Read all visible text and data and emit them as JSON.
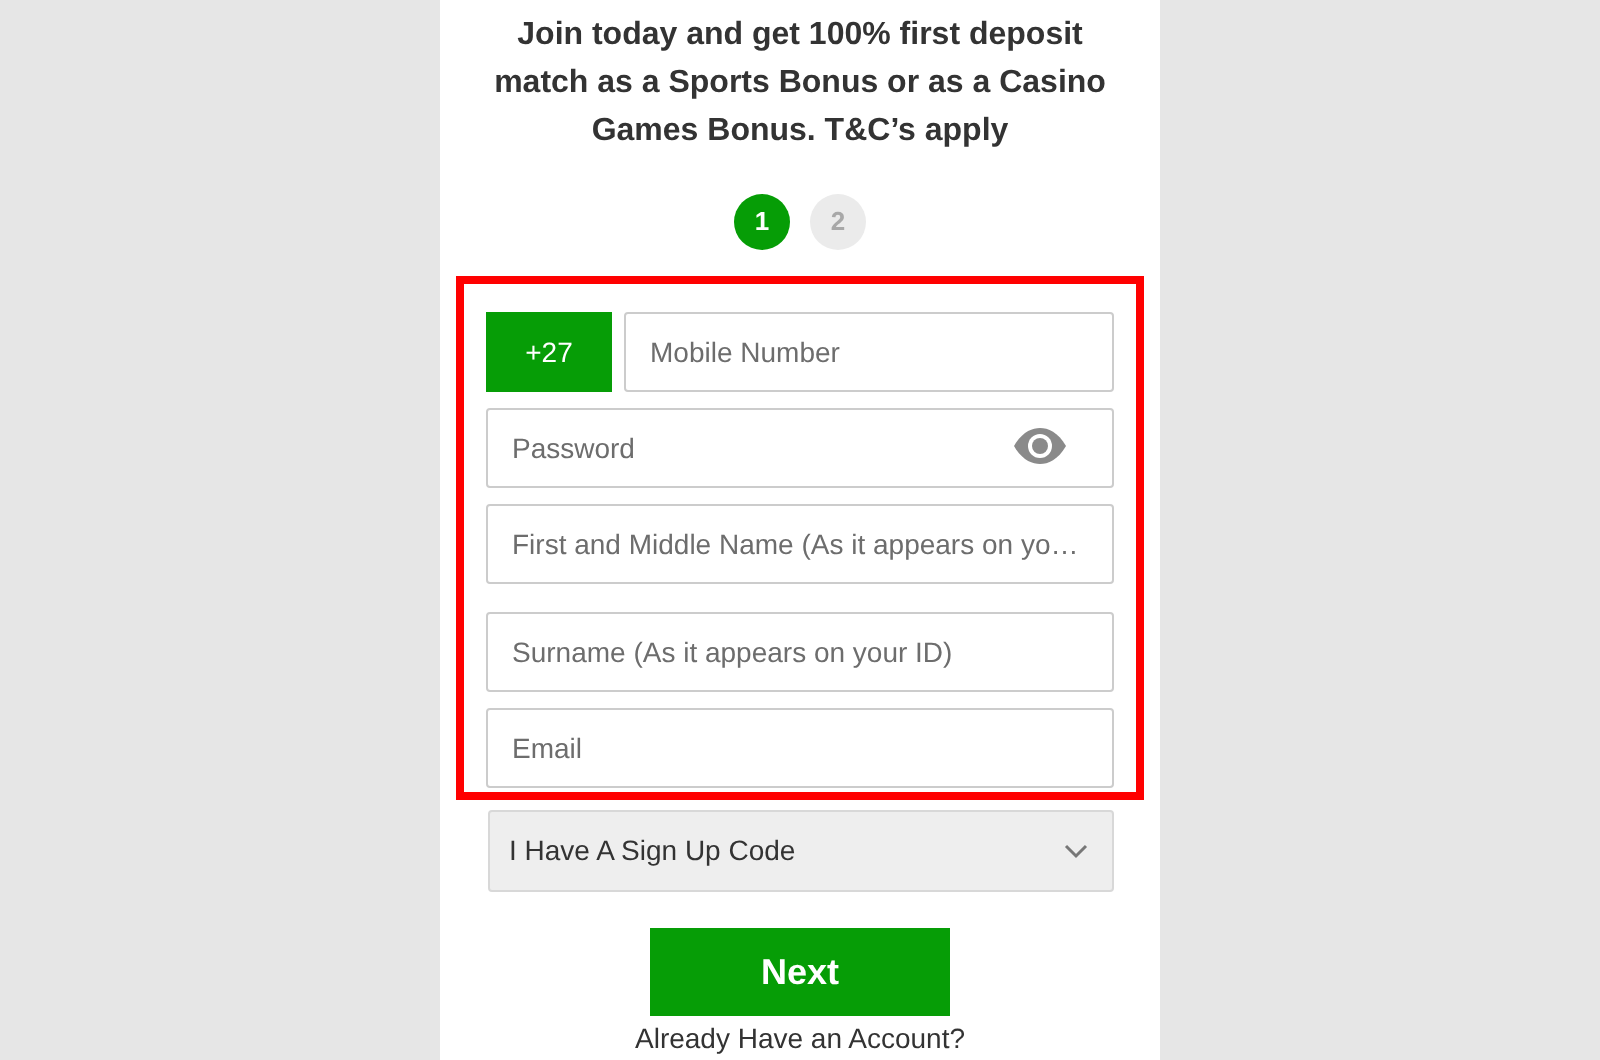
{
  "promo": "Join today and get 100% first deposit match as a Sports Bonus or as a Casino Games Bonus. T&C’s apply",
  "steps": [
    {
      "label": "1",
      "selected": true
    },
    {
      "label": "2",
      "selected": false
    }
  ],
  "form": {
    "country_code": "+27",
    "fields": [
      {
        "kind": "phone",
        "placeholder": "Mobile Number"
      },
      {
        "kind": "password",
        "placeholder": "Password"
      },
      {
        "kind": "text",
        "placeholder": "First and Middle Name (As it appears on yo…"
      },
      {
        "kind": "text",
        "placeholder": "Surname (As it appears on your ID)"
      },
      {
        "kind": "email",
        "placeholder": "Email"
      }
    ]
  },
  "signup_code": {
    "label": "I Have A Sign Up Code",
    "expanded": false
  },
  "next_button": "Next",
  "account_link": "Already Have an Account?"
}
